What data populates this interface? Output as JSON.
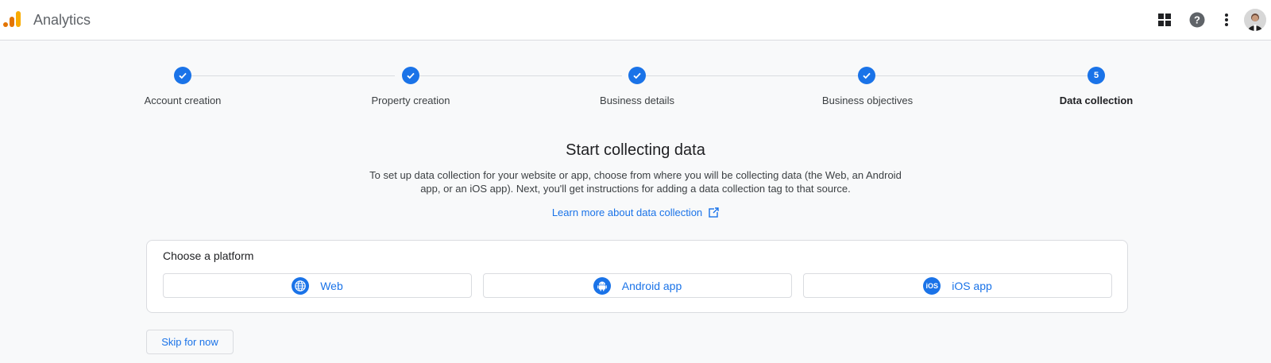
{
  "header": {
    "app_title": "Analytics",
    "icons": [
      "apps-grid-icon",
      "help-icon",
      "more-vert-icon"
    ]
  },
  "stepper": {
    "steps": [
      {
        "label": "Account creation",
        "state": "done"
      },
      {
        "label": "Property creation",
        "state": "done"
      },
      {
        "label": "Business details",
        "state": "done"
      },
      {
        "label": "Business objectives",
        "state": "done"
      },
      {
        "label": "Data collection",
        "state": "active",
        "number": "5"
      }
    ]
  },
  "main": {
    "title": "Start collecting data",
    "description": "To set up data collection for your website or app, choose from where you will be collecting data (the Web, an Android app, or an iOS app). Next, you'll get instructions for adding a data collection tag to that source.",
    "learn_more": "Learn more about data collection"
  },
  "platform": {
    "title": "Choose a platform",
    "options": [
      {
        "label": "Web",
        "icon": "globe-icon"
      },
      {
        "label": "Android app",
        "icon": "android-icon"
      },
      {
        "label": "iOS app",
        "icon": "ios-icon",
        "icon_text": "iOS"
      }
    ]
  },
  "skip_label": "Skip for now",
  "colors": {
    "accent": "#1a73e8",
    "background": "#f8f9fa",
    "border": "#dadce0"
  }
}
